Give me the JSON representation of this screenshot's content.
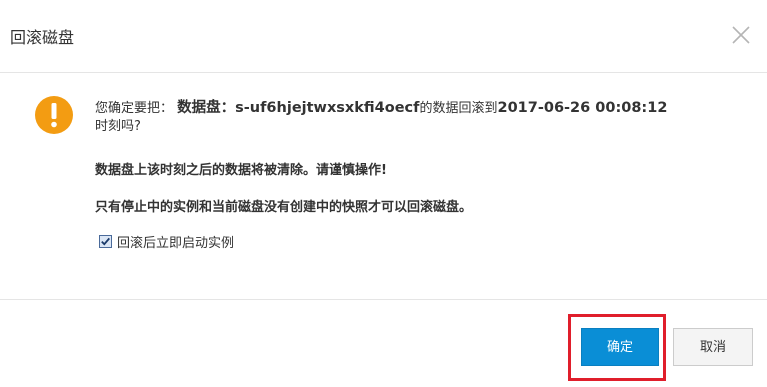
{
  "dialog": {
    "title": "回滚磁盘",
    "message": {
      "prefix": "您确定要把：",
      "disk_label": "数据盘：s-uf6hjejtwxsxkfi4oecf",
      "middle": "的数据回滚到",
      "timestamp": "2017-06-26 00:08:12",
      "suffix": "时刻吗?"
    },
    "warning_line": "数据盘上该时刻之后的数据将被清除。请谨慎操作!",
    "notice_line": "只有停止中的实例和当前磁盘没有创建中的快照才可以回滚磁盘。",
    "checkbox": {
      "label": "回滚后立即启动实例",
      "checked": true
    },
    "buttons": {
      "confirm": "确定",
      "cancel": "取消"
    }
  },
  "colors": {
    "primary": "#0a8ed6",
    "warning": "#f39c12",
    "highlight": "#e01e2b"
  },
  "icons": {
    "close": "close-icon",
    "warning": "warning-icon",
    "checkbox": "check-icon"
  }
}
